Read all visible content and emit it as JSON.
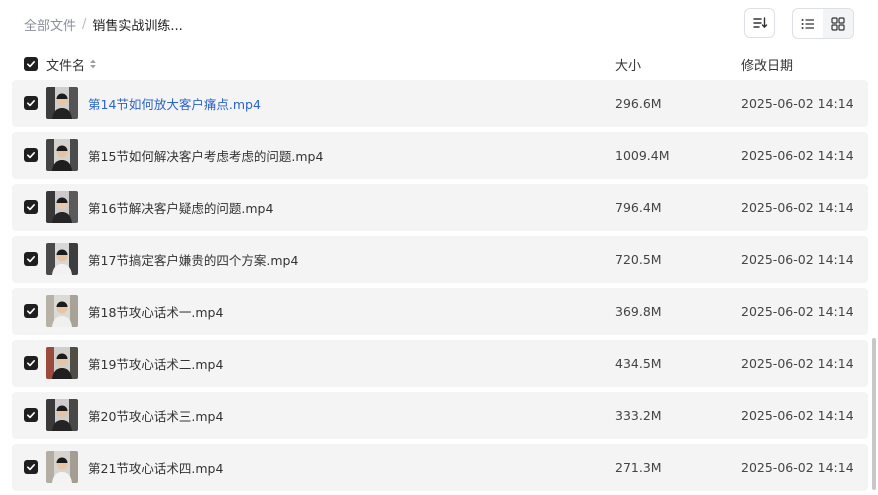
{
  "breadcrumb": {
    "root": "全部文件",
    "separator": "/",
    "current": "销售实战训练..."
  },
  "toolbar": {
    "sort_icon": "sort-descending-icon",
    "list_view_icon": "list-view-icon",
    "grid_view_icon": "grid-view-icon",
    "active_view": "list"
  },
  "columns": {
    "name": "文件名",
    "size": "大小",
    "modified": "修改日期"
  },
  "files": [
    {
      "name": "第14节如何放大客户痛点.mp4",
      "size": "296.6M",
      "modified": "2025-06-02 14:14",
      "selected": true,
      "hovered": true
    },
    {
      "name": "第15节如何解决客户考虑考虑的问题.mp4",
      "size": "1009.4M",
      "modified": "2025-06-02 14:14",
      "selected": true
    },
    {
      "name": "第16节解决客户疑虑的问题.mp4",
      "size": "796.4M",
      "modified": "2025-06-02 14:14",
      "selected": true
    },
    {
      "name": "第17节搞定客户嫌贵的四个方案.mp4",
      "size": "720.5M",
      "modified": "2025-06-02 14:14",
      "selected": true
    },
    {
      "name": "第18节攻心话术一.mp4",
      "size": "369.8M",
      "modified": "2025-06-02 14:14",
      "selected": true
    },
    {
      "name": "第19节攻心话术二.mp4",
      "size": "434.5M",
      "modified": "2025-06-02 14:14",
      "selected": true
    },
    {
      "name": "第20节攻心话术三.mp4",
      "size": "333.2M",
      "modified": "2025-06-02 14:14",
      "selected": true
    },
    {
      "name": "第21节攻心话术四.mp4",
      "size": "271.3M",
      "modified": "2025-06-02 14:14",
      "selected": true
    }
  ],
  "colors": {
    "link": "#2a63c9",
    "row_bg": "#f4f4f5",
    "checkbox": "#1f1f1f"
  }
}
